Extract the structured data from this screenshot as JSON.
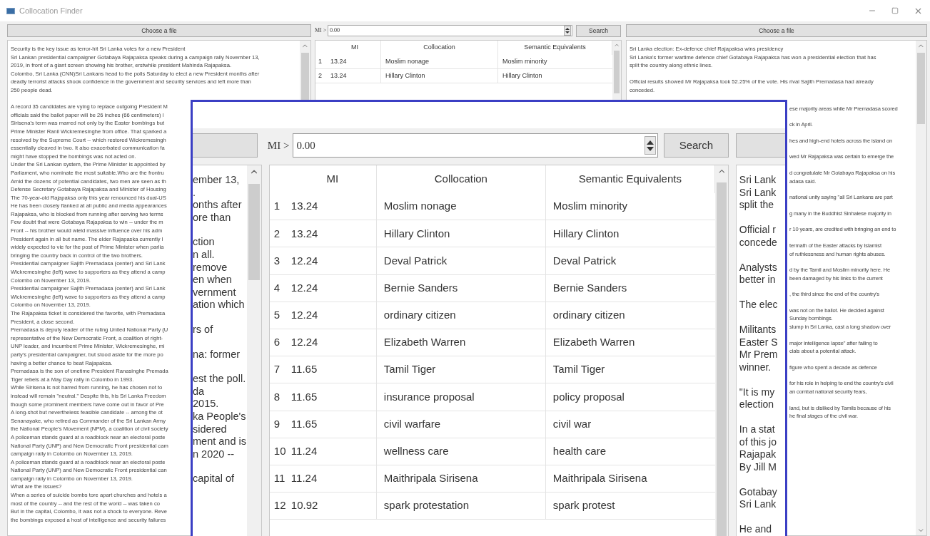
{
  "window": {
    "title": "Collocation Finder"
  },
  "left_file_button": "Choose a file",
  "filter": {
    "label": "MI >",
    "value": "0.00",
    "button": "Search"
  },
  "right_file_button": "Choose a file",
  "left_text": {
    "paragraphs": [
      [
        "Security is the key issue as terror-hit Sri Lanka votes for a new President",
        "Sri Lankan presidential campaigner Gotabaya Rajapaksa speaks during a campaign rally November 13,",
        "2019, in front of a giant screen showing his brother, erstwhile president Mahinda Rajapaksa.",
        "Colombo, Sri Lanka (CNN)Sri Lankans head to the polls Saturday to elect a new President months after",
        "deadly terrorist attacks shook confidence in the government and security services and left more than",
        "250 people dead."
      ],
      [
        "A record 35 candidates are vying to replace outgoing President M",
        "officials said the ballot paper will be 26 inches (66 centimeters) l",
        "Sirisena's term was marred not only by the Easter bombings but",
        "Prime Minister Ranil Wickremesinghe from office. That sparked a",
        "resolved by the Supreme Court -- which restored Wickremesingh",
        "essentially cleaved in two. It also exacerbated communication fa",
        "might have stopped the bombings was not acted on.",
        "Under the Sri Lankan system, the Prime Minister is appointed by",
        "Parliament, who nominate the most suitable.Who are the frontru",
        "Amid the dozens of potential candidates, two men are seen as th",
        "Defense Secretary Gotabaya Rajapaksa and Minister of Housing",
        "The 70-year-old Rajapaksa only this year renounced his dual-US",
        "He has been closely flanked at all public and media appearances",
        "Rajapaksa, who is blocked from running after serving two terms",
        "Few doubt that were Gotabaya Rajapaksa to win -- under the m",
        "Front -- his brother would wield massive influence over his adm",
        "President again in all but name. The elder Rajapaska currently l",
        "widely expected to vie for the post of Prime Minister when parlia",
        "bringing the country back in control of the two brothers.",
        "Presidential campaigner Sajith Premadasa (center) and Sri Lank",
        "Wickremesinghe (left) wave to supporters as they attend a camp",
        "Colombo on November 13, 2019.",
        "Presidential campaigner Sajith Premadasa (center) and Sri Lank",
        "Wickremesinghe (left) wave to supporters as they attend a camp",
        "Colombo on November 13, 2019.",
        "The Rajapaksa ticket is considered the favorite, with Premadasa",
        "President, a close second.",
        "Premadasa is deputy leader of the ruling United National Party (U",
        "representative of the New Democratic Front, a coalition of right-",
        "UNP leader, and incumbent Prime Minister, Wickremesinghe, mi",
        "party's presidential campaigner, but stood aside for the more po",
        "having a better chance to beat Rajapaksa.",
        "Premadasa is the son of onetime President Ranasinghe Premada",
        "Tiger rebels at a May Day rally in Colombo in 1993.",
        "While Sirisena is not barred from running, he has chosen not to",
        "instead will remain \"neutral.\" Despite this, his Sri Lanka Freedom",
        "though some prominent members have come out in favor of Pre",
        "A long-shot but nevertheless feasible candidate -- among the ot",
        "Senanayake, who retired as Commander of the Sri Lankan Army",
        "the National People's Movement (NPM), a coalition of civil society",
        "A policeman stands guard at a roadblock near an electoral poste",
        "National Party (UNP) and New Democratic Front presidential cam",
        "campaign rally in Colombo on November 13, 2019.",
        "A policeman stands guard at a roadblock near an electoral poste",
        "National Party (UNP) and New Democratic Front presidential can",
        "campaign rally in Colombo on November 13, 2019.",
        "What are the issues?",
        "When a series of suicide bombs tore apart churches and hotels a",
        "most of the country -- and the rest of the world -- was taken co",
        "But in the capital, Colombo, it was not a shock to everyone. Reve",
        "the bombings exposed a host of intelligence and security failures"
      ]
    ]
  },
  "table": {
    "columns": [
      "MI",
      "Collocation",
      "Semantic Equivalents"
    ],
    "rows": [
      {
        "index": "1",
        "mi": "13.24",
        "collocation": "Moslim nonage",
        "equivalent": "Moslim minority"
      },
      {
        "index": "2",
        "mi": "13.24",
        "collocation": "Hillary Clinton",
        "equivalent": "Hillary Clinton"
      }
    ]
  },
  "right_text": {
    "paragraphs": [
      [
        "Sri Lanka election: Ex-defence chief Rajapaksa wins presidency",
        "Sri Lanka's former wartime defence chief Gotabaya Rajapaksa has won a presidential election that has",
        "split the country along ethnic lines."
      ],
      [
        "Official results showed Mr Rajapaksa took 52.25% of the vote. His rival Sajith Premadasa had already",
        "conceded."
      ]
    ],
    "fragments": [
      [
        "ese majority areas while Mr Premadasa scored"
      ],
      [
        "ck in April."
      ],
      [
        "hes and high-end hotels across the island on"
      ],
      [
        "wed Mr Rajapaksa was certain to emerge the"
      ],
      [
        "d congratulate Mr Gotabaya Rajapaksa on his",
        "adasa said."
      ],
      [
        "national unity saying \"all Sri Lankans are part"
      ],
      [
        "g many in the Buddhist Sinhalese majority in"
      ],
      [
        "r 10 years, are credited with bringing an end to"
      ],
      [
        "termath of the Easter attacks by Islamist",
        "of ruthlessness and human rights abuses."
      ],
      [
        "d by the Tamil and Moslim minority here. He",
        "been damaged by his links to the current"
      ],
      [
        ", the third since the end of the country's"
      ],
      [
        "was not on the ballot. He decided against",
        "Sunday bombings.",
        "slump in Sri Lanka, cast a long shadow over"
      ],
      [
        "major intelligence lapse\" after failing to",
        "cials about a potential attack."
      ],
      [
        "figure who spent a decade as defence"
      ],
      [
        "for his role in helping to end the country's civil",
        "an combat national security fears,"
      ],
      [
        "land, but is disliked by Tamils because of his",
        "he final stages of the civil war."
      ]
    ]
  },
  "magnifier": {
    "filter": {
      "label": "MI >",
      "value": "0.00",
      "button": "Search"
    },
    "left_fragments": [
      [
        "ember 13,",
        ".",
        "onths after",
        "ore than"
      ],
      [
        "ction",
        "n all.",
        "remove",
        "en when",
        "vernment",
        "ation which"
      ],
      [
        "rs of"
      ],
      [
        "na: former"
      ],
      [
        "est the poll.",
        "da",
        "2015.",
        "ka People's",
        "sidered",
        "ment and is",
        "n 2020 --"
      ],
      [
        "capital of"
      ]
    ],
    "table": {
      "columns": [
        "MI",
        "Collocation",
        "Semantic Equivalents"
      ],
      "rows": [
        {
          "index": "1",
          "mi": "13.24",
          "collocation": "Moslim nonage",
          "equivalent": "Moslim minority"
        },
        {
          "index": "2",
          "mi": "13.24",
          "collocation": "Hillary Clinton",
          "equivalent": "Hillary Clinton"
        },
        {
          "index": "3",
          "mi": "12.24",
          "collocation": "Deval Patrick",
          "equivalent": "Deval Patrick"
        },
        {
          "index": "4",
          "mi": "12.24",
          "collocation": "Bernie Sanders",
          "equivalent": "Bernie Sanders"
        },
        {
          "index": "5",
          "mi": "12.24",
          "collocation": "ordinary citizen",
          "equivalent": "ordinary citizen"
        },
        {
          "index": "6",
          "mi": "12.24",
          "collocation": "Elizabeth Warren",
          "equivalent": "Elizabeth Warren"
        },
        {
          "index": "7",
          "mi": "11.65",
          "collocation": "Tamil Tiger",
          "equivalent": "Tamil Tiger"
        },
        {
          "index": "8",
          "mi": "11.65",
          "collocation": "insurance proposal",
          "equivalent": "policy proposal"
        },
        {
          "index": "9",
          "mi": "11.65",
          "collocation": "civil warfare",
          "equivalent": "civil war"
        },
        {
          "index": "10",
          "mi": "11.24",
          "collocation": "wellness care",
          "equivalent": "health care"
        },
        {
          "index": "11",
          "mi": "11.24",
          "collocation": "Maithripala Sirisena",
          "equivalent": "Maithripala Sirisena"
        },
        {
          "index": "12",
          "mi": "10.92",
          "collocation": "spark protestation",
          "equivalent": "spark protest"
        }
      ]
    },
    "right_fragments": [
      [
        "Sri Lank",
        "Sri Lank",
        "split the"
      ],
      [
        "Official r",
        "concede"
      ],
      [
        "Analysts",
        "better in"
      ],
      [
        "The elec"
      ],
      [
        "Militants",
        "Easter S",
        "Mr Prem",
        "winner."
      ],
      [
        "\"It is my",
        "election"
      ],
      [
        "In a stat",
        "of this jo",
        "Rajapak",
        "By Jill M"
      ],
      [
        "Gotabay",
        "Sri Lank"
      ],
      [
        "He and"
      ]
    ]
  }
}
